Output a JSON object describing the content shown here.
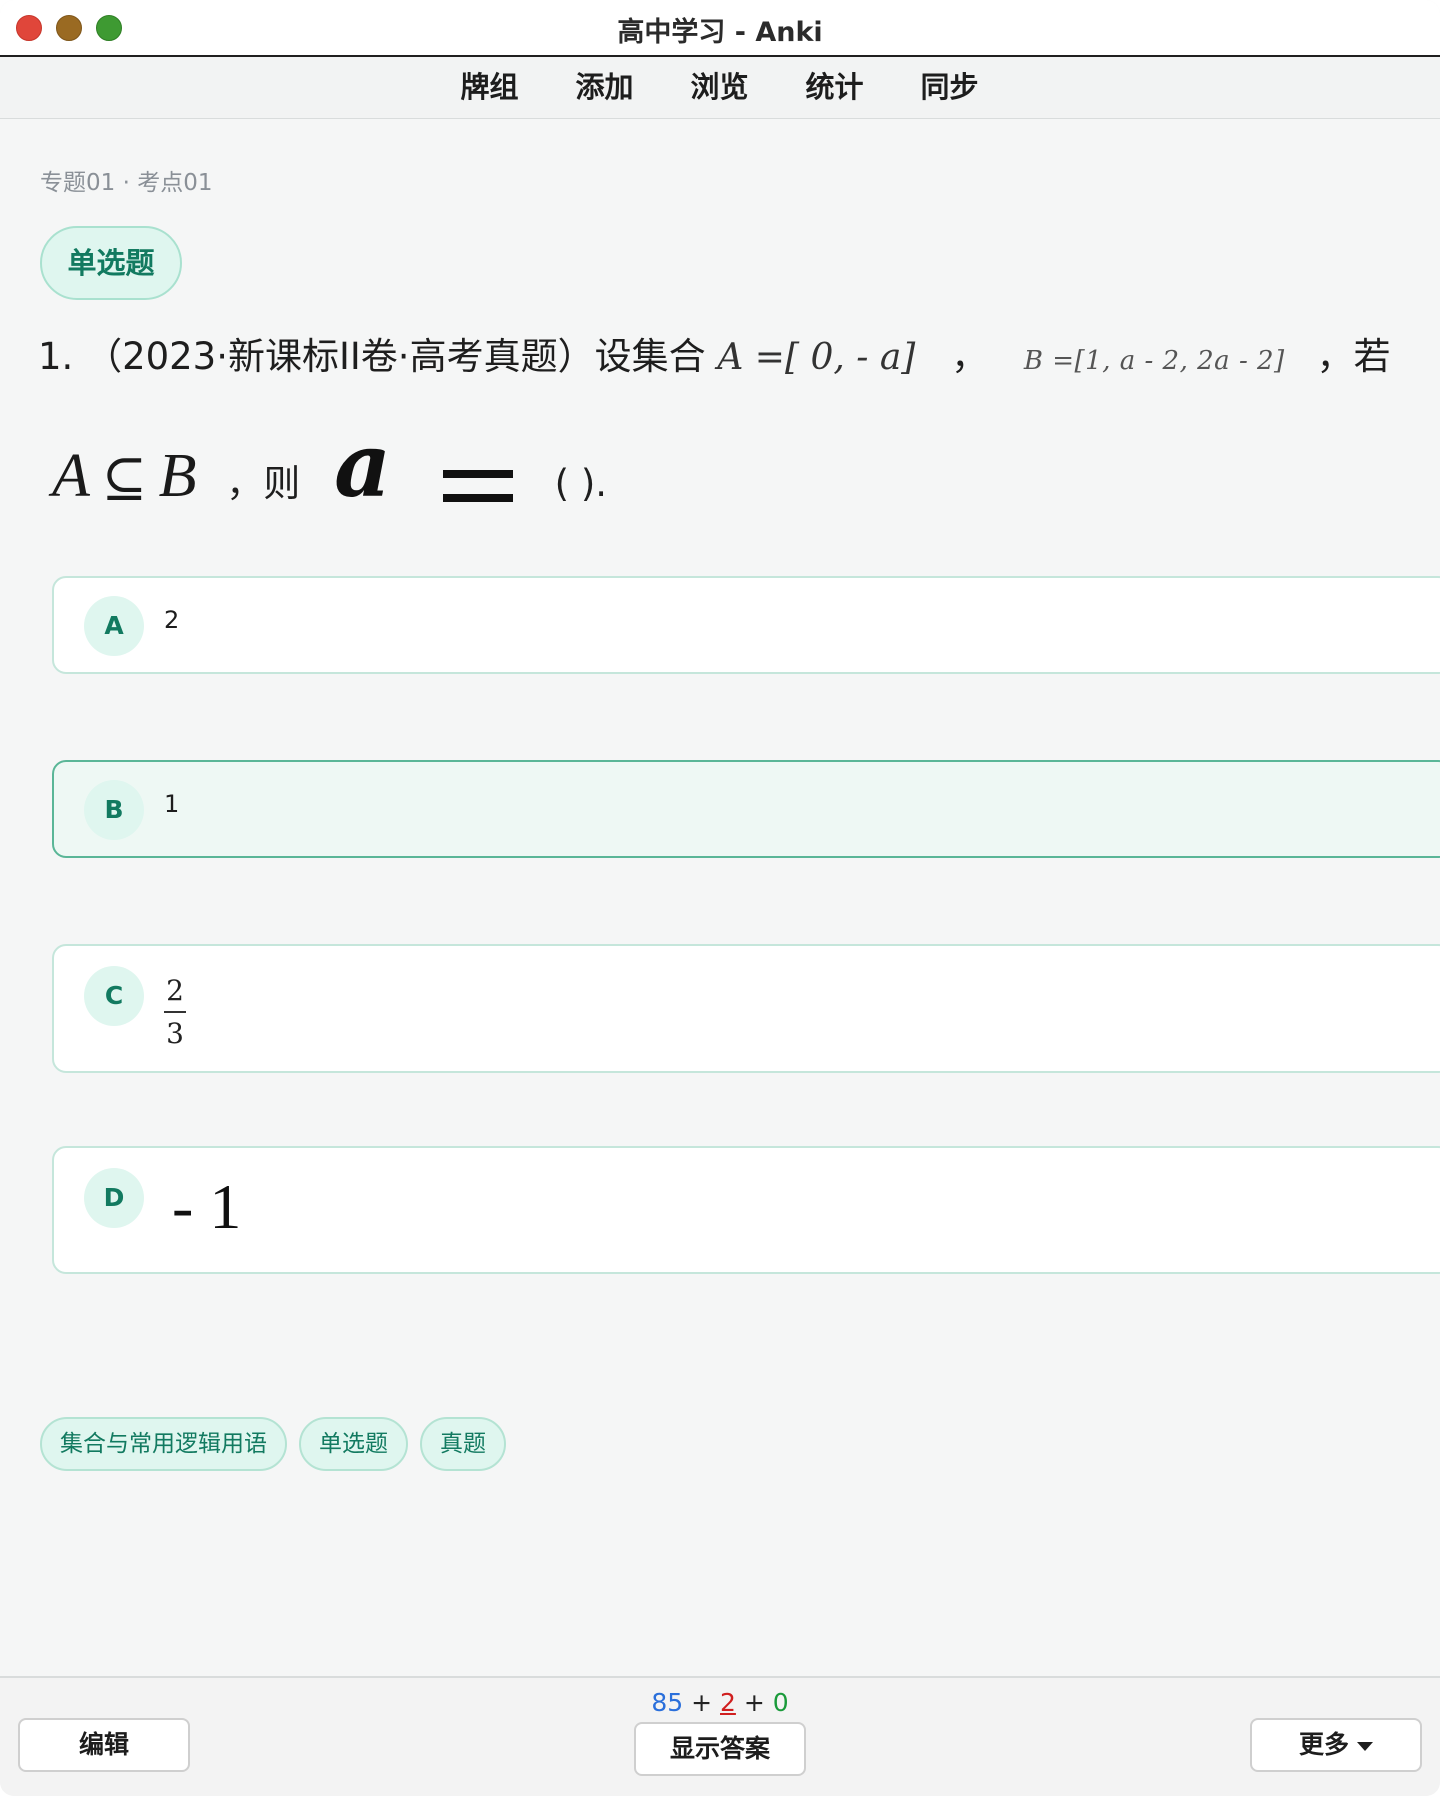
{
  "window": {
    "title": "高中学习 - Anki"
  },
  "toolbar": {
    "items": [
      "牌组",
      "添加",
      "浏览",
      "统计",
      "同步"
    ]
  },
  "card": {
    "breadcrumb": "专题01 · 考点01",
    "type_label": "单选题",
    "question": {
      "prefix": "1. （2023·新课标II卷·高考真题）设集合",
      "set_a": "A =[ 0, - a]",
      "sep1": "，",
      "set_b": "B =[1, a - 2, 2a - 2]",
      "sep2": "，若",
      "subset_left": "A",
      "subset_sym": "⊆",
      "subset_right": "B",
      "then": "，则",
      "var": "a",
      "tail": "( )."
    },
    "options": [
      {
        "letter": "A",
        "text": "2"
      },
      {
        "letter": "B",
        "text": "1"
      },
      {
        "letter": "C",
        "numerator": "2",
        "denominator": "3"
      },
      {
        "letter": "D",
        "text": "- 1"
      }
    ],
    "selected_option": "B",
    "tags": [
      "集合与常用逻辑用语",
      "单选题",
      "真题"
    ]
  },
  "bottom": {
    "counts": {
      "new": "85",
      "learning": "2",
      "review": "0",
      "plus": "+"
    },
    "edit_label": "编辑",
    "show_answer_label": "显示答案",
    "more_label": "更多"
  }
}
